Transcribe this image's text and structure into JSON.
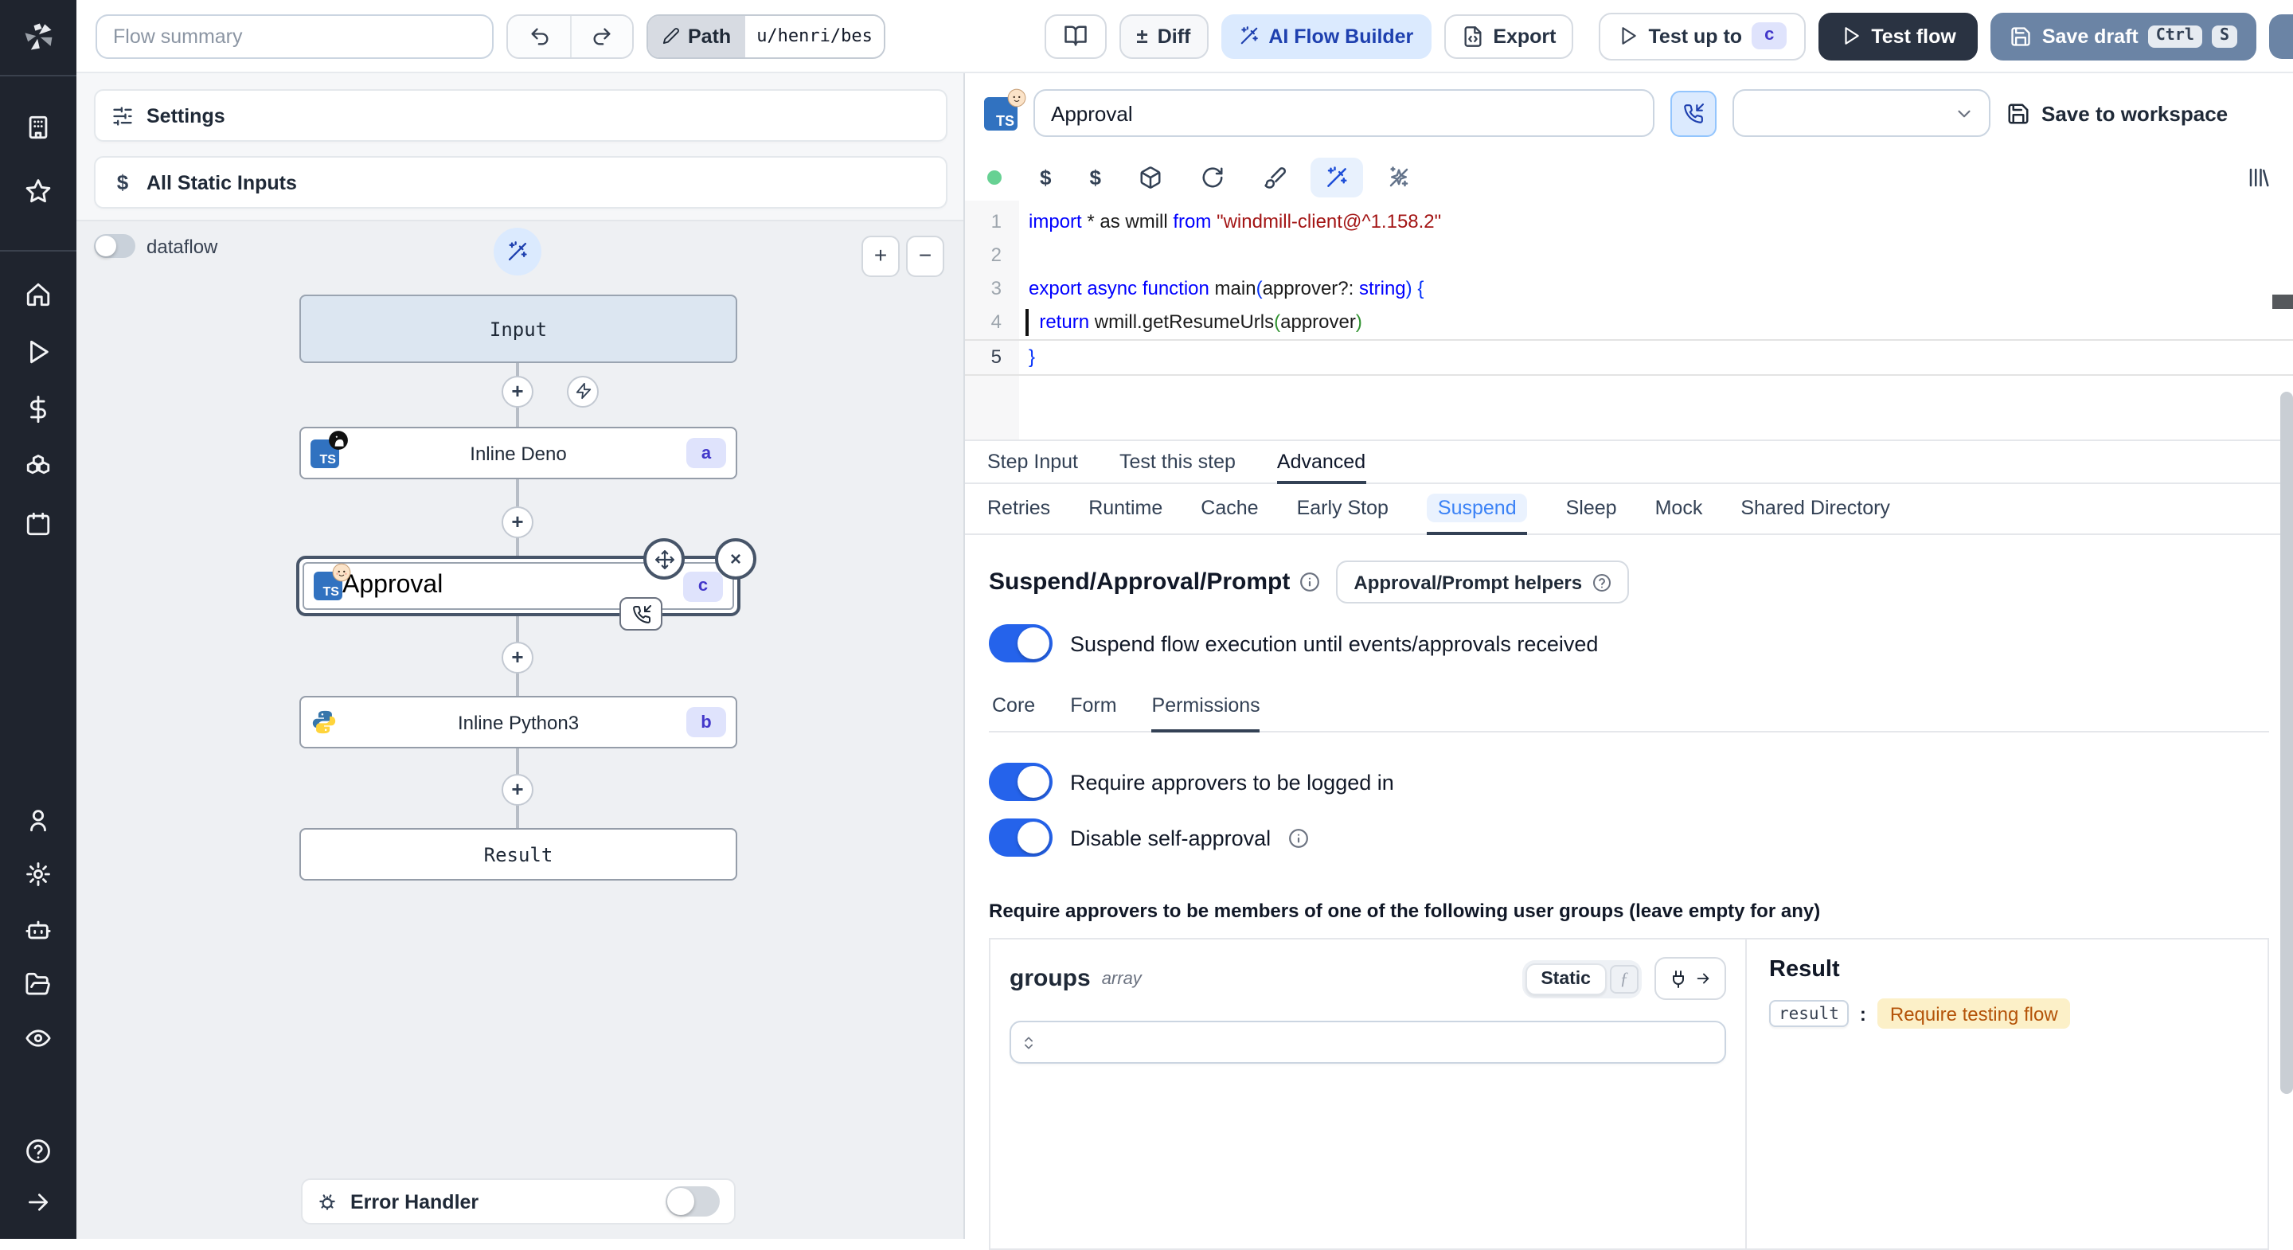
{
  "topbar": {
    "flow_summary_placeholder": "Flow summary",
    "path_label": "Path",
    "path_value": "u/henri/bes",
    "diff_label": "Diff",
    "ai_flow_builder_label": "AI Flow Builder",
    "export_label": "Export",
    "test_up_to_label": "Test up to",
    "test_up_to_badge": "c",
    "test_flow_label": "Test flow",
    "save_draft_label": "Save draft",
    "save_draft_kbd": [
      "Ctrl",
      "S"
    ]
  },
  "flow_panel": {
    "settings_label": "Settings",
    "static_inputs_label": "All Static Inputs",
    "dataflow_label": "dataflow",
    "dataflow_on": false,
    "zoom_in": "+",
    "zoom_out": "−",
    "nodes": {
      "input": {
        "label": "Input"
      },
      "deno": {
        "label": "Inline Deno",
        "badge": "a"
      },
      "approval": {
        "label": "Approval",
        "badge": "c",
        "selected": true
      },
      "python": {
        "label": "Inline Python3",
        "badge": "b"
      },
      "result": {
        "label": "Result"
      }
    },
    "error_handler": {
      "label": "Error Handler",
      "enabled": false
    }
  },
  "step": {
    "name_value": "Approval",
    "language_select_value": "",
    "save_to_workspace_label": "Save to workspace"
  },
  "code": {
    "lines": [
      {
        "num": "1",
        "tokens": [
          [
            "kw",
            "import"
          ],
          [
            "pl",
            " * as wmill "
          ],
          [
            "kw",
            "from"
          ],
          [
            "pl",
            " "
          ],
          [
            "str",
            "\"windmill-client@^1.158.2\""
          ]
        ]
      },
      {
        "num": "2",
        "tokens": []
      },
      {
        "num": "3",
        "tokens": [
          [
            "kw",
            "export"
          ],
          [
            "pl",
            " "
          ],
          [
            "kw",
            "async"
          ],
          [
            "pl",
            " "
          ],
          [
            "kw",
            "function"
          ],
          [
            "pl",
            " main"
          ],
          [
            "b1",
            "("
          ],
          [
            "pl",
            "approver?: "
          ],
          [
            "kw",
            "string"
          ],
          [
            "b1",
            ")"
          ],
          [
            "pl",
            " "
          ],
          [
            "b1",
            "{"
          ]
        ]
      },
      {
        "num": "4",
        "cursor": true,
        "tokens": [
          [
            "pl",
            "  "
          ],
          [
            "kw",
            "return"
          ],
          [
            "pl",
            " wmill.getResumeUrls"
          ],
          [
            "b2",
            "("
          ],
          [
            "pl",
            "approver"
          ],
          [
            "b2",
            ")"
          ]
        ]
      },
      {
        "num": "5",
        "current": true,
        "tokens": [
          [
            "b1",
            "}"
          ]
        ]
      }
    ]
  },
  "editor": {
    "tabs": [
      {
        "label": "Step Input"
      },
      {
        "label": "Test this step"
      },
      {
        "label": "Advanced",
        "active": true
      }
    ],
    "subtabs": [
      "Retries",
      "Runtime",
      "Cache",
      "Early Stop",
      "Suspend",
      "Sleep",
      "Mock",
      "Shared Directory"
    ],
    "active_subtab": "Suspend"
  },
  "suspend": {
    "heading": "Suspend/Approval/Prompt",
    "helpers_button_label": "Approval/Prompt helpers",
    "suspend_toggle_label": "Suspend flow execution until events/approvals received",
    "suspend_toggle_on": true,
    "perm_tabs": [
      "Core",
      "Form",
      "Permissions"
    ],
    "active_perm_tab": "Permissions",
    "require_login_label": "Require approvers to be logged in",
    "require_login_on": true,
    "disable_self_approval_label": "Disable self-approval",
    "disable_self_approval_on": true,
    "groups_heading": "Require approvers to be members of one of the following user groups (leave empty for any)",
    "groups_field": {
      "name": "groups",
      "type": "array",
      "static_label": "Static"
    },
    "result_panel": {
      "heading": "Result",
      "key": "result",
      "separator": ":",
      "value": "Require testing flow"
    }
  },
  "icons": {
    "plus": "+",
    "close": "×",
    "function": "ƒ",
    "dollar": "$",
    "plusminus": "±",
    "ts_logo": "TS"
  },
  "colors": {
    "accent_blue": "#2563eb",
    "badge_bg": "#dfe3fc",
    "badge_text": "#4338ca",
    "result_warning_bg": "#fcf0c8",
    "result_warning_text": "#b45309"
  }
}
